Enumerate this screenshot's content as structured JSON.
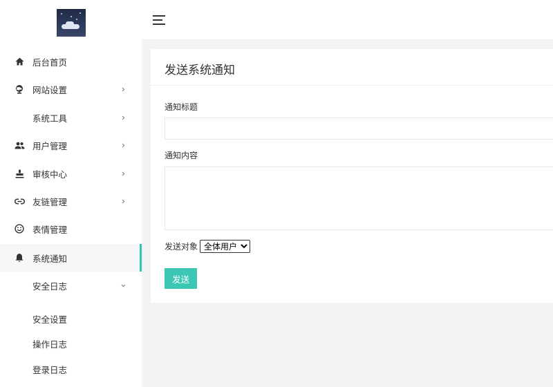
{
  "sidebar": {
    "items": [
      {
        "label": "后台首页",
        "icon": "home-icon",
        "has_arrow": false
      },
      {
        "label": "网站设置",
        "icon": "globe-icon",
        "has_arrow": true
      },
      {
        "label": "系统工具",
        "icon": "",
        "has_arrow": true
      },
      {
        "label": "用户管理",
        "icon": "users-icon",
        "has_arrow": true
      },
      {
        "label": "审核中心",
        "icon": "stamp-icon",
        "has_arrow": true
      },
      {
        "label": "友链管理",
        "icon": "link-icon",
        "has_arrow": true
      },
      {
        "label": "表情管理",
        "icon": "smiley-icon",
        "has_arrow": false
      },
      {
        "label": "系统通知",
        "icon": "bell-icon",
        "has_arrow": false,
        "active": true
      },
      {
        "label": "安全日志",
        "icon": "",
        "has_arrow": true,
        "expanded": true
      }
    ],
    "submenu": [
      {
        "label": "安全设置"
      },
      {
        "label": "操作日志"
      },
      {
        "label": "登录日志"
      }
    ]
  },
  "card": {
    "title": "发送系统通知",
    "title_label": "通知标题",
    "title_value": "",
    "content_label": "通知内容",
    "content_value": "",
    "target_label": "发送对象",
    "target_selected": "全体用户",
    "send_label": "发送"
  },
  "colors": {
    "accent": "#3cc7b5",
    "active_bar": "#2ec4b6",
    "page_bg": "#f2f3f5"
  }
}
